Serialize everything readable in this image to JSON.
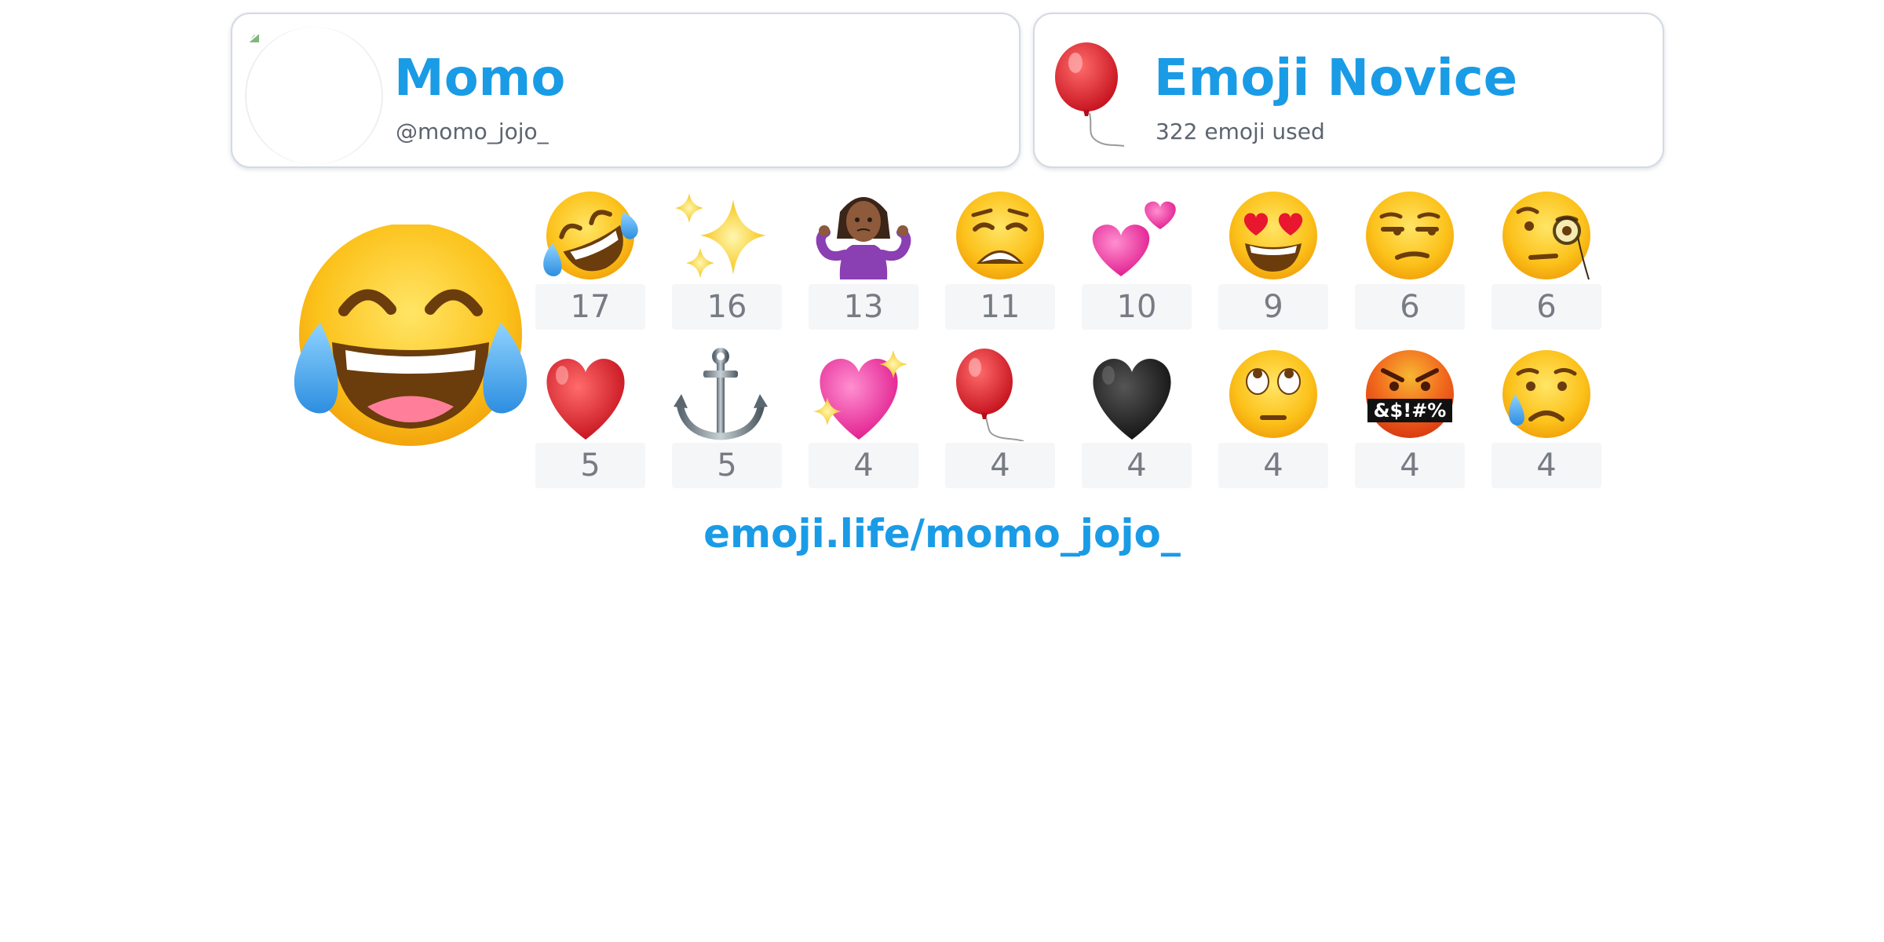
{
  "profile": {
    "display_name": "Momo",
    "handle": "@momo_jojo_"
  },
  "rank": {
    "title": "Emoji Novice",
    "subtitle": "322 emoji used",
    "emoji_icon": "balloon-icon"
  },
  "top_emoji": {
    "icon": "face-with-tears-of-joy-icon"
  },
  "emoji_counts": [
    {
      "icon": "rolling-on-the-floor-laughing-icon",
      "count": "17"
    },
    {
      "icon": "sparkles-icon",
      "count": "16"
    },
    {
      "icon": "woman-shrugging-icon",
      "count": "13"
    },
    {
      "icon": "weary-face-icon",
      "count": "11"
    },
    {
      "icon": "two-hearts-icon",
      "count": "10"
    },
    {
      "icon": "smiling-face-with-heart-eyes-icon",
      "count": "9"
    },
    {
      "icon": "unamused-face-icon",
      "count": "6"
    },
    {
      "icon": "face-with-monocle-icon",
      "count": "6"
    },
    {
      "icon": "red-heart-icon",
      "count": "5"
    },
    {
      "icon": "anchor-icon",
      "count": "5"
    },
    {
      "icon": "sparkling-heart-icon",
      "count": "4"
    },
    {
      "icon": "balloon-icon",
      "count": "4"
    },
    {
      "icon": "black-heart-icon",
      "count": "4"
    },
    {
      "icon": "face-with-rolling-eyes-icon",
      "count": "4"
    },
    {
      "icon": "face-with-symbols-on-mouth-icon",
      "count": "4"
    },
    {
      "icon": "crying-face-icon",
      "count": "4"
    }
  ],
  "share_link": "emoji.life/momo_jojo_",
  "colors": {
    "accent": "#1a9be6",
    "muted_text": "#5c6470",
    "count_bg": "#f5f6f8",
    "count_text": "#777c84"
  }
}
